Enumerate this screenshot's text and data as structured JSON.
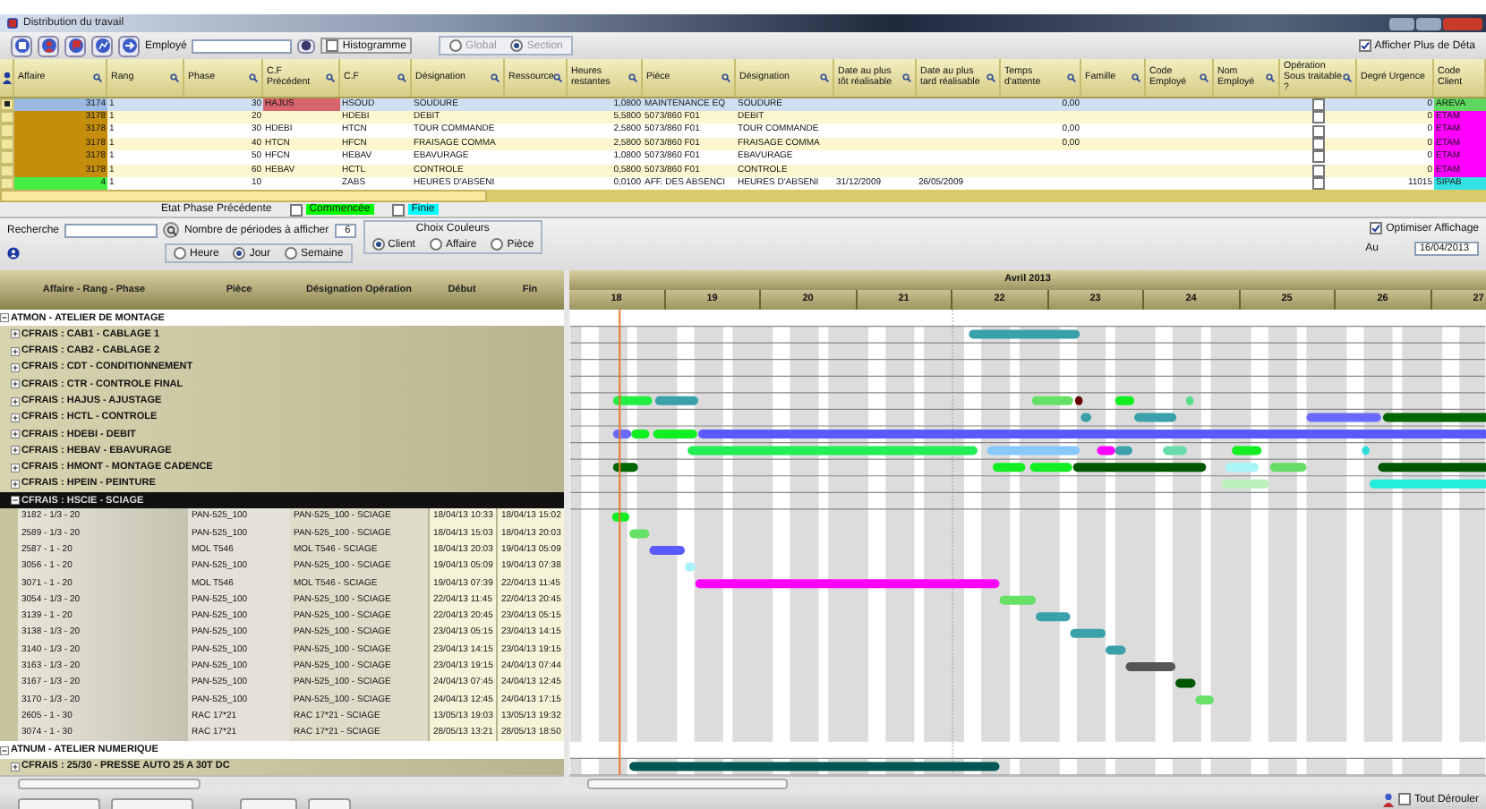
{
  "window": {
    "title": "Distribution du travail"
  },
  "toolbar": {
    "employee_label": "Employé",
    "histogram": {
      "label": "Histogramme",
      "checked": false
    },
    "scope_disabled": true,
    "scope_options": [
      {
        "label": "Global",
        "selected": false
      },
      {
        "label": "Section",
        "selected": true
      }
    ],
    "details": {
      "label": "Afficher Plus de Déta",
      "checked": true
    }
  },
  "grid": {
    "columns": [
      "Affaire",
      "Rang",
      "Phase",
      "C.F Précédent",
      "C.F",
      "Désignation",
      "Ressource",
      "Heures restantes",
      "Pièce",
      "Désignation",
      "Date au plus tôt réalisable",
      "Date au plus tard réalisable",
      "Temps d'attente",
      "Famille",
      "Code Employé",
      "Nom Employé",
      "Opération Sous traitable ?",
      "Degré Urgence",
      "Code Client"
    ],
    "rows": [
      {
        "selected": true,
        "subcontractable": false,
        "affaire": {
          "text": "3174",
          "color": "#9cb9e2"
        },
        "rang": "1",
        "phase": "30",
        "cf_prev": {
          "text": "HAJUS",
          "color": "#d7636c"
        },
        "cf": "HSOUD",
        "designation": "SOUDURE",
        "hours": "1,0800",
        "piece": "MAINTENANCE EQ",
        "piece_designation": "SOUDURE",
        "wait": "0,00",
        "urgency": "0",
        "client": {
          "text": "AREVA",
          "color": "#5fd65f"
        }
      },
      {
        "selected": false,
        "subcontractable": false,
        "affaire": {
          "text": "3178",
          "color": "#c48d0c"
        },
        "rang": "1",
        "phase": "20",
        "cf": "HDEBI",
        "designation": "DEBIT",
        "hours": "5,5800",
        "piece": "5073/860 F01",
        "piece_designation": "DEBIT",
        "urgency": "0",
        "client": {
          "text": "ETAM",
          "color": "#ff00ff"
        }
      },
      {
        "selected": false,
        "subcontractable": false,
        "affaire": {
          "text": "3178",
          "color": "#c48d0c"
        },
        "rang": "1",
        "phase": "30",
        "cf_prev": {
          "text": "HDEBI"
        },
        "cf": "HTCN",
        "designation": "TOUR COMMANDE",
        "hours": "2,5800",
        "piece": "5073/860 F01",
        "piece_designation": "TOUR COMMANDE",
        "wait": "0,00",
        "urgency": "0",
        "client": {
          "text": "ETAM",
          "color": "#ff00ff"
        }
      },
      {
        "selected": false,
        "subcontractable": false,
        "affaire": {
          "text": "3178",
          "color": "#c48d0c"
        },
        "rang": "1",
        "phase": "40",
        "cf_prev": {
          "text": "HTCN"
        },
        "cf": "HFCN",
        "designation": "FRAISAGE COMMA",
        "hours": "2,5800",
        "piece": "5073/860 F01",
        "piece_designation": "FRAISAGE COMMA",
        "wait": "0,00",
        "urgency": "0",
        "client": {
          "text": "ETAM",
          "color": "#ff00ff"
        }
      },
      {
        "selected": false,
        "subcontractable": false,
        "affaire": {
          "text": "3178",
          "color": "#c48d0c"
        },
        "rang": "1",
        "phase": "50",
        "cf_prev": {
          "text": "HFCN"
        },
        "cf": "HEBAV",
        "designation": "EBAVURAGE",
        "hours": "1,0800",
        "piece": "5073/860 F01",
        "piece_designation": "EBAVURAGE",
        "urgency": "0",
        "client": {
          "text": "ETAM",
          "color": "#ff00ff"
        }
      },
      {
        "selected": false,
        "subcontractable": false,
        "affaire": {
          "text": "3178",
          "color": "#c48d0c"
        },
        "rang": "1",
        "phase": "60",
        "cf_prev": {
          "text": "HEBAV"
        },
        "cf": "HCTL",
        "designation": "CONTROLE",
        "hours": "0,5800",
        "piece": "5073/860 F01",
        "piece_designation": "CONTROLE",
        "urgency": "0",
        "client": {
          "text": "ETAM",
          "color": "#ff00ff"
        }
      },
      {
        "selected": false,
        "subcontractable": false,
        "affaire": {
          "text": "4",
          "color": "#44ee44"
        },
        "rang": "1",
        "phase": "10",
        "cf": "ZABS",
        "designation": "HEURES D'ABSENI",
        "hours": "0,0100",
        "piece": "AFF. DES ABSENCI",
        "piece_designation": "HEURES D'ABSENI",
        "earliest": "31/12/2009",
        "latest": "26/05/2009",
        "urgency": "11015",
        "client": {
          "text": "SIPAB",
          "color": "#33e3e3"
        }
      }
    ]
  },
  "state_legend": {
    "label": "Etat Phase Précédente",
    "items": [
      {
        "label": "Commencée",
        "checked": false,
        "color": "#00ff00"
      },
      {
        "label": "Finie",
        "checked": false,
        "color": "#00ffff"
      }
    ]
  },
  "search": {
    "label": "Recherche",
    "periods_label": "Nombre de périodes à afficher",
    "periods_value": "6",
    "periods": [
      {
        "label": "Heure",
        "selected": false
      },
      {
        "label": "Jour",
        "selected": true
      },
      {
        "label": "Semaine",
        "selected": false
      }
    ],
    "colors_title": "Choix Couleurs",
    "color_modes": [
      {
        "label": "Client",
        "selected": true
      },
      {
        "label": "Affaire",
        "selected": false
      },
      {
        "label": "Pièce",
        "selected": false
      }
    ],
    "optimize": {
      "label": "Optimiser Affichage",
      "checked": true
    },
    "date_label": "Au",
    "date": "16/04/2013"
  },
  "tree": {
    "columns": [
      "Affaire - Rang - Phase",
      "Pièce",
      "Désignation Opération",
      "Début",
      "Fin"
    ],
    "nodes": [
      {
        "label": "ATMON - ATELIER DE MONTAGE",
        "expanded": true,
        "selected": false,
        "children": [
          {
            "label": "CFRAIS : CAB1 - CABLAGE 1",
            "expanded": false,
            "selected": false
          },
          {
            "label": "CFRAIS : CAB2 - CABLAGE 2",
            "expanded": false,
            "selected": false
          },
          {
            "label": "CFRAIS : CDT - CONDITIONNEMENT",
            "expanded": false,
            "selected": false
          },
          {
            "label": "CFRAIS : CTR - CONTROLE FINAL",
            "expanded": false,
            "selected": false
          },
          {
            "label": "CFRAIS : HAJUS - AJUSTAGE",
            "expanded": false,
            "selected": false
          },
          {
            "label": "CFRAIS : HCTL - CONTROLE",
            "expanded": false,
            "selected": false
          },
          {
            "label": "CFRAIS : HDEBI - DEBIT",
            "expanded": false,
            "selected": false
          },
          {
            "label": "CFRAIS : HEBAV - EBAVURAGE",
            "expanded": false,
            "selected": false
          },
          {
            "label": "CFRAIS : HMONT - MONTAGE CADENCE",
            "expanded": false,
            "selected": false
          },
          {
            "label": "CFRAIS : HPEIN - PEINTURE",
            "expanded": false,
            "selected": false
          },
          {
            "label": "CFRAIS : HSCIE - SCIAGE",
            "expanded": true,
            "selected": true,
            "children": [
              {
                "cells": [
                  "3182 - 1/3 - 20",
                  "PAN-525_100",
                  "PAN-525_100 - SCIAGE",
                  "18/04/13 10:33",
                  "18/04/13 15:02"
                ]
              },
              {
                "cells": [
                  "2589 - 1/3 - 20",
                  "PAN-525_100",
                  "PAN-525_100 - SCIAGE",
                  "18/04/13 15:03",
                  "18/04/13 20:03"
                ]
              },
              {
                "cells": [
                  "2587 - 1 - 20",
                  "MOL T546",
                  "MOL T546 - SCIAGE",
                  "18/04/13 20:03",
                  "19/04/13 05:09"
                ]
              },
              {
                "cells": [
                  "3056 - 1 - 20",
                  "PAN-525_100",
                  "PAN-525_100 - SCIAGE",
                  "19/04/13 05:09",
                  "19/04/13 07:38"
                ]
              },
              {
                "cells": [
                  "3071 - 1 - 20",
                  "MOL T546",
                  "MOL T546 - SCIAGE",
                  "19/04/13 07:39",
                  "22/04/13 11:45"
                ]
              },
              {
                "cells": [
                  "3054 - 1/3 - 20",
                  "PAN-525_100",
                  "PAN-525_100 - SCIAGE",
                  "22/04/13 11:45",
                  "22/04/13 20:45"
                ]
              },
              {
                "cells": [
                  "3139 - 1 - 20",
                  "PAN-525_100",
                  "PAN-525_100 - SCIAGE",
                  "22/04/13 20:45",
                  "23/04/13 05:15"
                ]
              },
              {
                "cells": [
                  "3138 - 1/3 - 20",
                  "PAN-525_100",
                  "PAN-525_100 - SCIAGE",
                  "23/04/13 05:15",
                  "23/04/13 14:15"
                ]
              },
              {
                "cells": [
                  "3140 - 1/3 - 20",
                  "PAN-525_100",
                  "PAN-525_100 - SCIAGE",
                  "23/04/13 14:15",
                  "23/04/13 19:15"
                ]
              },
              {
                "cells": [
                  "3163 - 1/3 - 20",
                  "PAN-525_100",
                  "PAN-525_100 - SCIAGE",
                  "23/04/13 19:15",
                  "24/04/13 07:44"
                ]
              },
              {
                "cells": [
                  "3167 - 1/3 - 20",
                  "PAN-525_100",
                  "PAN-525_100 - SCIAGE",
                  "24/04/13 07:45",
                  "24/04/13 12:45"
                ]
              },
              {
                "cells": [
                  "3170 - 1/3 - 20",
                  "PAN-525_100",
                  "PAN-525_100 - SCIAGE",
                  "24/04/13 12:45",
                  "24/04/13 17:15"
                ]
              },
              {
                "cells": [
                  "2605 - 1 - 30",
                  "RAC 17*21",
                  "RAC 17*21 - SCIAGE",
                  "13/05/13 19:03",
                  "13/05/13 19:32"
                ]
              },
              {
                "cells": [
                  "3074 - 1 - 30",
                  "RAC 17*21",
                  "RAC 17*21 - SCIAGE",
                  "28/05/13 13:21",
                  "28/05/13 18:50"
                ]
              }
            ]
          }
        ]
      },
      {
        "label": "ATNUM - ATELIER NUMERIQUE",
        "expanded": true,
        "selected": false,
        "children": [
          {
            "label": "CFRAIS : 25/30 - PRESSE AUTO 25 A 30T DC",
            "expanded": false,
            "selected": false
          }
        ]
      }
    ]
  },
  "gantt": {
    "month": "Avril 2013",
    "days": [
      "18",
      "19",
      "20",
      "21",
      "22",
      "23",
      "24",
      "25",
      "26",
      "27"
    ]
  },
  "footer": {
    "expand_all": {
      "label": "Tout Dérouler",
      "checked": false
    }
  }
}
